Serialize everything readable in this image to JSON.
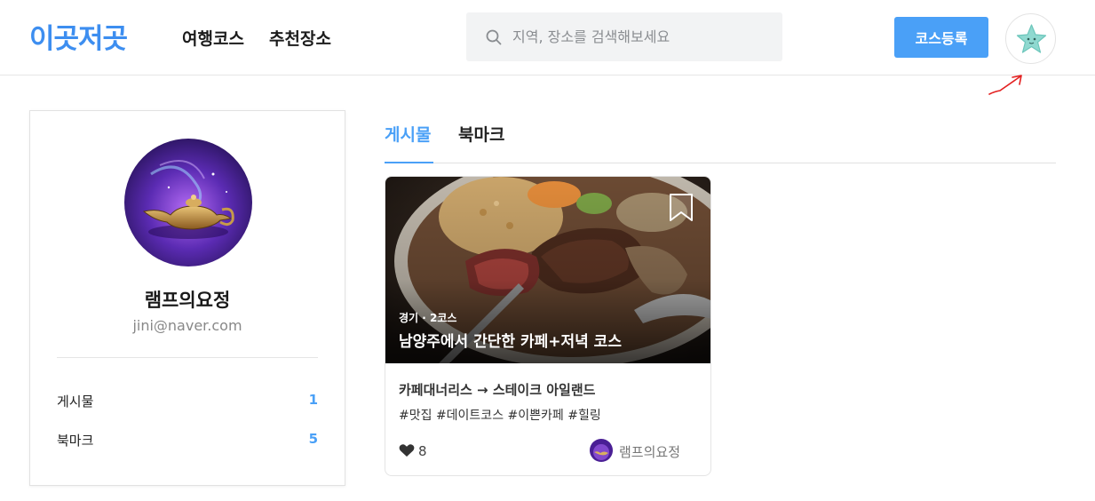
{
  "header": {
    "logo": "이곳저곳",
    "nav": [
      {
        "label": "여행코스"
      },
      {
        "label": "추천장소"
      }
    ],
    "search": {
      "placeholder": "지역, 장소를 검색해보세요",
      "value": ""
    },
    "register_button": "코스등록",
    "colors": {
      "brand": "#3d8ef0",
      "accent": "#4aa0f7"
    }
  },
  "profile": {
    "name": "램프의요정",
    "email": "jini@naver.com",
    "stats": [
      {
        "label": "게시물",
        "value": "1"
      },
      {
        "label": "북마크",
        "value": "5"
      }
    ]
  },
  "tabs": [
    {
      "label": "게시물",
      "active": true
    },
    {
      "label": "북마크",
      "active": false
    }
  ],
  "courses": [
    {
      "region": "경기 · 2코스",
      "title": "남양주에서 간단한 카페+저녁 코스",
      "route": "카페대너리스 → 스테이크 아일랜드",
      "tags": "#맛집 #데이트코스 #이쁜카페 #힐링",
      "likes": "8",
      "author": "램프의요정",
      "bookmarked": false
    }
  ]
}
